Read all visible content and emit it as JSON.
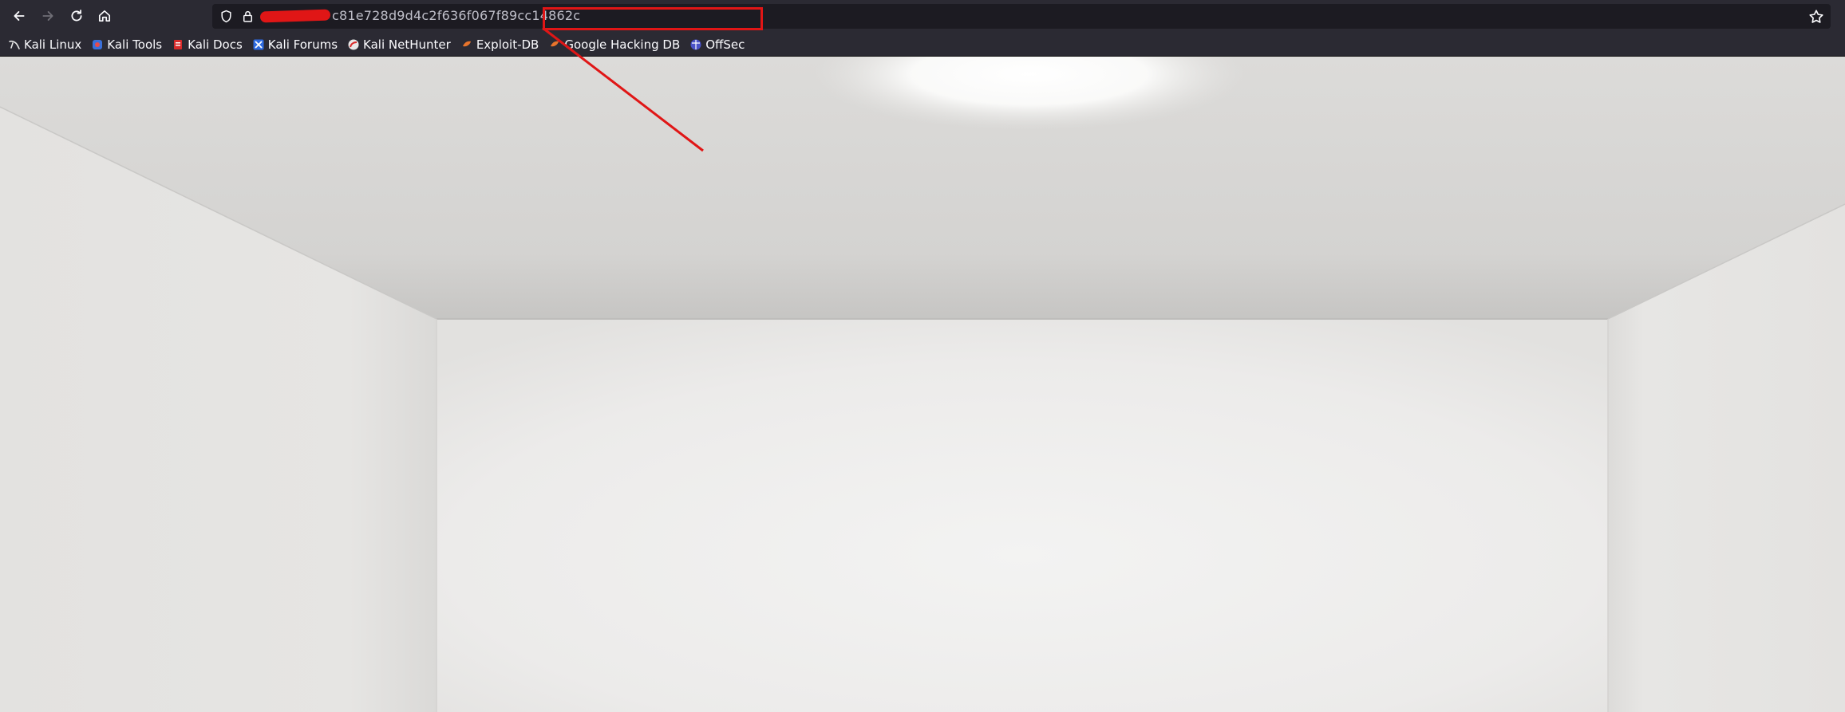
{
  "browser": {
    "url_visible_text": "c81e728d9d4c2f636f067f89cc14862c",
    "icons": {
      "back": "back-arrow-icon",
      "forward": "forward-arrow-icon",
      "reload": "reload-icon",
      "home": "home-icon",
      "tracking": "shield-icon",
      "security": "lock-icon",
      "bookmark_star": "star-icon"
    }
  },
  "bookmarks": [
    {
      "label": "Kali Linux",
      "icon": "kali-dragon-icon"
    },
    {
      "label": "Kali Tools",
      "icon": "kali-tools-icon"
    },
    {
      "label": "Kali Docs",
      "icon": "kali-docs-icon"
    },
    {
      "label": "Kali Forums",
      "icon": "kali-forums-icon"
    },
    {
      "label": "Kali NetHunter",
      "icon": "nethunter-icon"
    },
    {
      "label": "Exploit-DB",
      "icon": "exploit-db-icon"
    },
    {
      "label": "Google Hacking DB",
      "icon": "ghdb-icon"
    },
    {
      "label": "OffSec",
      "icon": "offsec-icon"
    }
  ],
  "colors": {
    "chrome_bg": "#2b2a33",
    "urlbar_bg": "#1c1b22",
    "annotation_red": "#e01616"
  }
}
